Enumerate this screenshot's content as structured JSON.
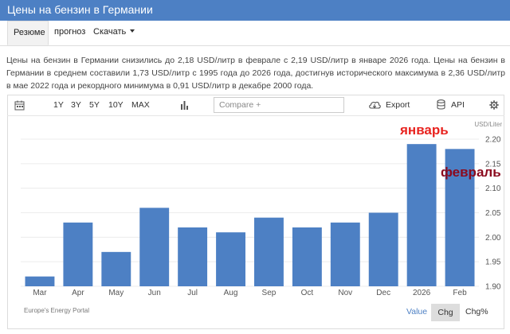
{
  "header": {
    "title": "Цены на бензин в Германии"
  },
  "tabs": [
    {
      "label": "Резюме"
    },
    {
      "label": "прогноз"
    },
    {
      "label": "Скачать"
    }
  ],
  "summary": "Цены на бензин в Германии снизились до 2,18 USD/литр в феврале с 2,19 USD/литр в январе 2026 года. Цены на бензин в Германии в среднем составили 1,73 USD/литр с 1995 года до 2026 года, достигнув исторического максимума в 2,36 USD/литр в мае 2022 года и рекордного минимума в 0,91 USD/литр в декабре 2000 года.",
  "toolbar": {
    "ranges": [
      "1Y",
      "3Y",
      "5Y",
      "10Y",
      "MAX"
    ],
    "compare_placeholder": "Compare +",
    "export_label": "Export",
    "api_label": "API",
    "icons": [
      "calendar-icon",
      "bar-chart-icon",
      "cloud-download-icon",
      "database-icon",
      "gear-icon"
    ]
  },
  "chart_data": {
    "type": "bar",
    "categories": [
      "Mar",
      "Apr",
      "May",
      "Jun",
      "Jul",
      "Aug",
      "Sep",
      "Oct",
      "Nov",
      "Dec",
      "2026",
      "Feb"
    ],
    "values": [
      1.92,
      2.03,
      1.97,
      2.06,
      2.02,
      2.01,
      2.04,
      2.02,
      2.03,
      2.05,
      2.19,
      2.18
    ],
    "ylim": [
      1.9,
      2.2
    ],
    "yticks": [
      1.9,
      1.95,
      2.0,
      2.05,
      2.1,
      2.15,
      2.2
    ],
    "unit": "USD/Liter",
    "grid": true,
    "bar_color": "#4d80c4",
    "annotations": [
      {
        "text": "январь",
        "color": "#e8231f"
      },
      {
        "text": "февраль",
        "color": "#8b0a1e"
      }
    ]
  },
  "footer": {
    "source": "Europe's Energy Portal",
    "views": [
      "Value",
      "Chg",
      "Chg%"
    ]
  }
}
